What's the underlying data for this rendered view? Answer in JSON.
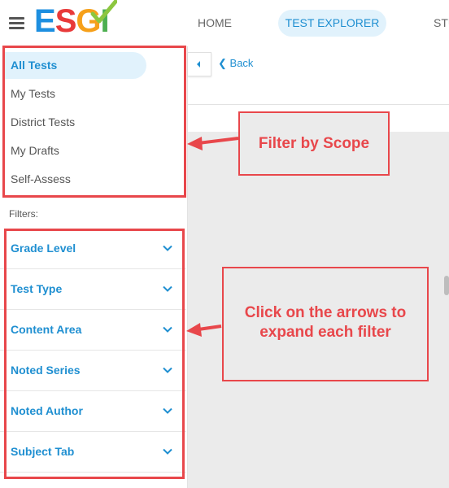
{
  "header": {
    "logo_text": "ESGI",
    "nav": [
      {
        "label": "HOME"
      },
      {
        "label": "TEST EXPLORER",
        "active": true
      },
      {
        "label": "STU"
      }
    ]
  },
  "sidebar": {
    "scopes": [
      {
        "label": "All Tests",
        "active": true
      },
      {
        "label": "My Tests"
      },
      {
        "label": "District Tests"
      },
      {
        "label": "My Drafts"
      },
      {
        "label": "Self-Assess"
      }
    ],
    "filters_label": "Filters:",
    "filters": [
      {
        "label": "Grade Level"
      },
      {
        "label": "Test Type"
      },
      {
        "label": "Content Area"
      },
      {
        "label": "Noted Series"
      },
      {
        "label": "Noted Author"
      },
      {
        "label": "Subject Tab"
      }
    ]
  },
  "main": {
    "back_label": "Back"
  },
  "annotations": {
    "scope_callout": "Filter by Scope",
    "filters_callout_line1": "Click on the arrows to",
    "filters_callout_line2": "expand each filter"
  },
  "colors": {
    "accent": "#1f8fd1",
    "active_bg": "#e1f2fc",
    "annotation_red": "#e8474b"
  }
}
